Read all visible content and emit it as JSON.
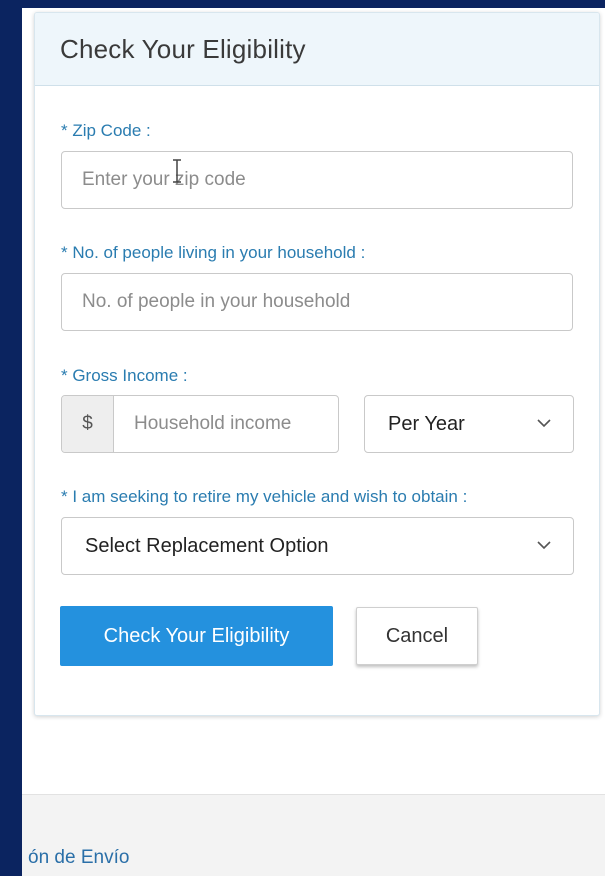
{
  "form": {
    "title": "Check Your Eligibility",
    "zip": {
      "label": "* Zip Code :",
      "placeholder": "Enter your zip code"
    },
    "household": {
      "label": "* No. of people living in your household :",
      "placeholder": "No. of people in your household"
    },
    "income": {
      "label": "* Gross Income :",
      "currency_symbol": "$",
      "placeholder": "Household income",
      "period_selected": "Per Year"
    },
    "replacement": {
      "label": "* I am seeking to retire my vehicle and wish to obtain :",
      "selected": "Select Replacement Option"
    },
    "buttons": {
      "submit": "Check Your Eligibility",
      "cancel": "Cancel"
    }
  },
  "footer": {
    "link_text": "ón de Envío"
  },
  "colors": {
    "page_background": "#0b2460",
    "label": "#2a7cb0",
    "primary_button": "#2491de"
  },
  "icons": {
    "cursor": "text-cursor-icon",
    "dropdown": "chevron-down-icon"
  }
}
